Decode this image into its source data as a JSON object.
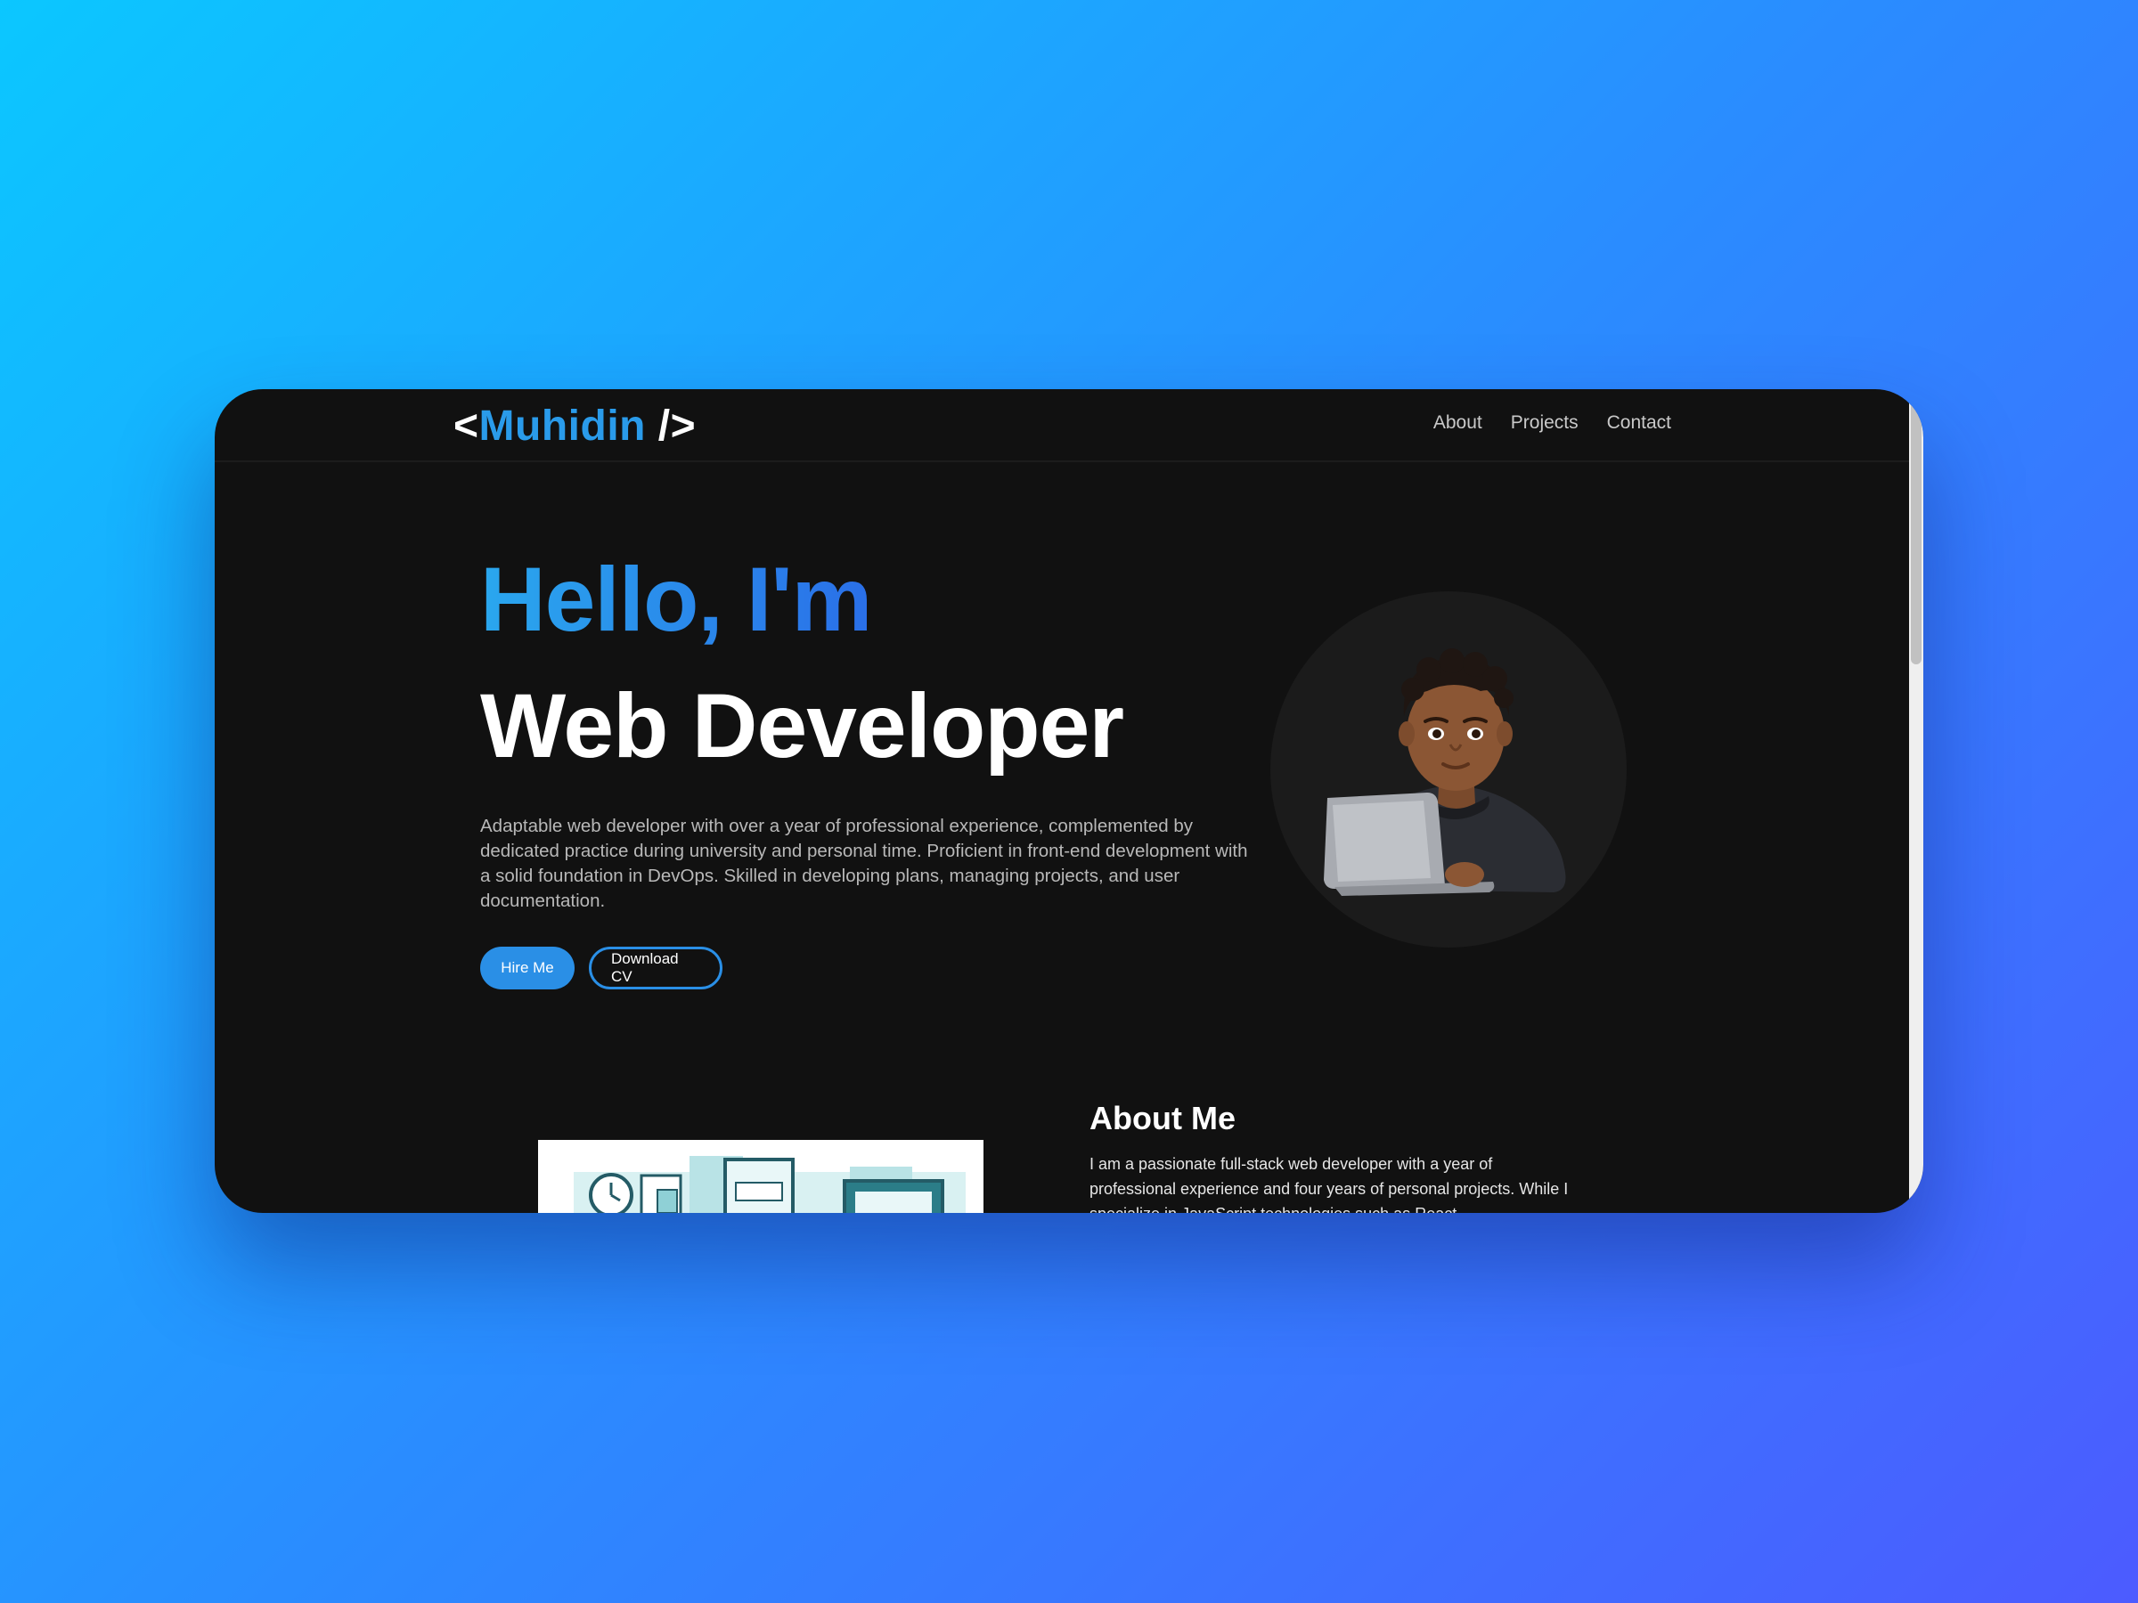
{
  "brand": {
    "open": "<",
    "name": "Muhidin",
    "close": " />"
  },
  "nav": {
    "items": [
      {
        "label": "About"
      },
      {
        "label": "Projects"
      },
      {
        "label": "Contact"
      }
    ]
  },
  "hero": {
    "greeting": "Hello, I'm",
    "role": "Web Developer",
    "description": "Adaptable web developer with over a year of professional experience, complemented by dedicated practice during university and personal time. Proficient in front-end development with a solid foundation in DevOps. Skilled in developing plans, managing projects, and user documentation.",
    "primary_button": "Hire Me",
    "secondary_button": "Download CV",
    "avatar_icon": "developer-avatar-icon"
  },
  "about": {
    "title": "About Me",
    "text": "I am a passionate full-stack web developer with a year of professional experience and four years of personal projects. While I specialize in JavaScript technologies such as React",
    "image_icon": "workspace-illustration-icon"
  },
  "colors": {
    "background_start": "#0bc7ff",
    "background_end": "#4c5bff",
    "window": "#111111",
    "accent": "#2a8fe6",
    "brand_name": "#2a9bea"
  }
}
